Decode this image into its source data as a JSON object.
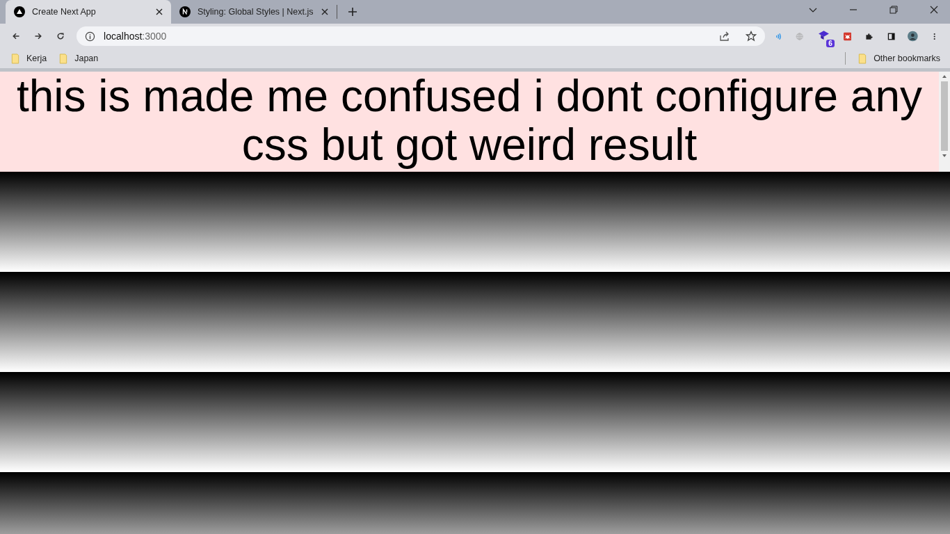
{
  "tabs": [
    {
      "title": "Create Next App",
      "selected": true
    },
    {
      "title": "Styling: Global Styles | Next.js",
      "selected": false
    }
  ],
  "address": {
    "host": "localhost",
    "port": ":3000"
  },
  "extension_badge": "6",
  "bookmarks": [
    {
      "label": "Kerja"
    },
    {
      "label": "Japan"
    }
  ],
  "other_bookmarks": "Other bookmarks",
  "page": {
    "heading": "this is made me confused i dont configure any css but got weird result"
  }
}
